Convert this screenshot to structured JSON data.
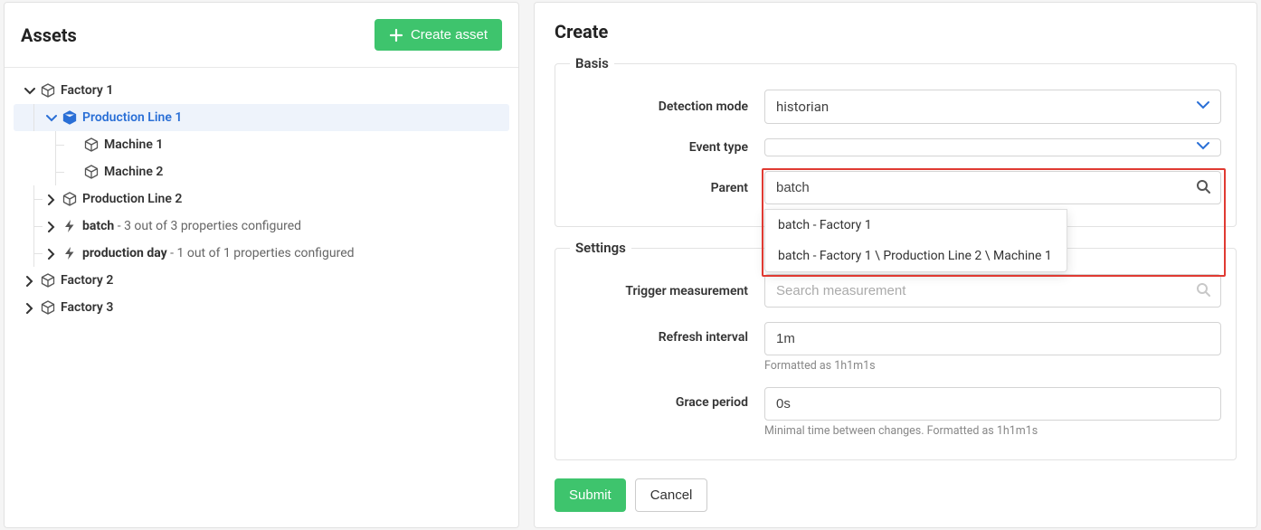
{
  "left": {
    "title": "Assets",
    "create_button": "Create asset"
  },
  "tree": {
    "factory1": "Factory 1",
    "pl1": "Production Line 1",
    "m1": "Machine 1",
    "m2": "Machine 2",
    "pl2": "Production Line 2",
    "batch_name": "batch",
    "batch_sub": " - 3 out of 3 properties configured",
    "pday_name": "production day",
    "pday_sub": " - 1 out of 1 properties configured",
    "factory2": "Factory 2",
    "factory3": "Factory 3"
  },
  "right": {
    "title": "Create",
    "basis_legend": "Basis",
    "detection_label": "Detection mode",
    "detection_value": "historian",
    "eventtype_label": "Event type",
    "eventtype_value": "",
    "parent_label": "Parent",
    "parent_value": "batch",
    "settings_legend": "Settings",
    "trigger_label": "Trigger measurement",
    "trigger_placeholder": "Search measurement",
    "refresh_label": "Refresh interval",
    "refresh_value": "1m",
    "refresh_help": "Formatted as 1h1m1s",
    "grace_label": "Grace period",
    "grace_value": "0s",
    "grace_help": "Minimal time between changes. Formatted as 1h1m1s",
    "submit": "Submit",
    "cancel": "Cancel",
    "dropdown": {
      "opt1": "batch - Factory 1",
      "opt2": "batch - Factory 1 \\ Production Line 2 \\ Machine 1"
    }
  }
}
